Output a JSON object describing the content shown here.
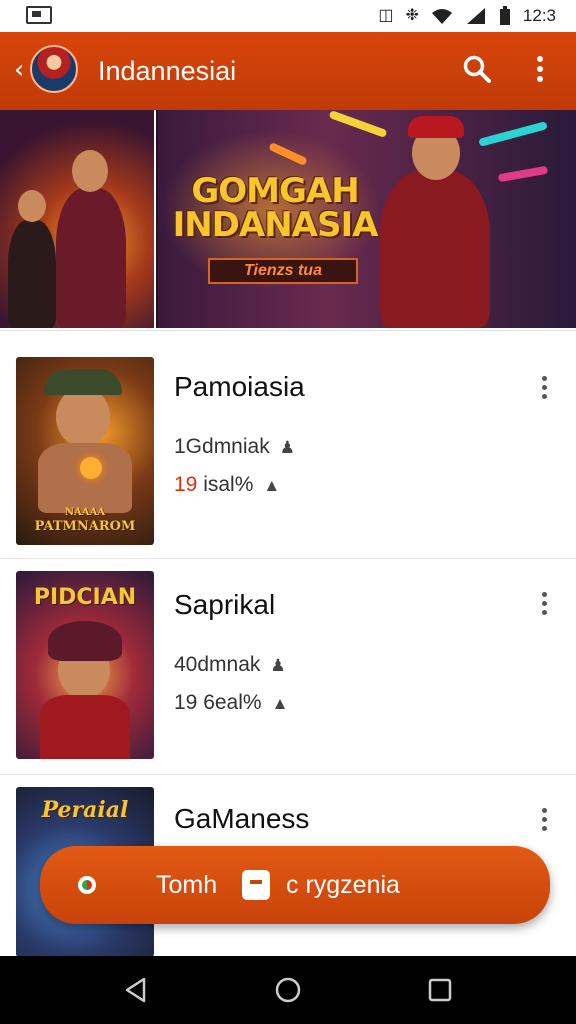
{
  "status_bar": {
    "time": "12:3",
    "icons": [
      "notification-icon",
      "vibrate-icon",
      "wifi-icon",
      "signal-icon",
      "battery-icon"
    ]
  },
  "app_bar": {
    "title": "Indannesiai",
    "back_icon": "chevron-left-icon",
    "search_icon": "search-icon",
    "more_icon": "more-vertical-icon"
  },
  "banner": {
    "title_line1": "GOMGAH",
    "title_line2": "INDANASIA",
    "subtitle": "Tienzs tua"
  },
  "list": {
    "items": [
      {
        "title": "Pamoiasia",
        "line1": "1Gdmniak",
        "line2_num": "19",
        "line2_text": "isal%",
        "thumb_label": "PATMNAROM",
        "thumb_top_label": "NAAAA"
      },
      {
        "title": "Saprikal",
        "line1": "40dmnak",
        "line2_num": "19",
        "line2_text": "6eal%",
        "thumb_label": "PIDCIAN",
        "thumb_top_label": ""
      },
      {
        "title": "GaManess",
        "line1": "",
        "line2_num": "",
        "line2_text": "",
        "thumb_label": "Peraial",
        "thumb_top_label": ""
      }
    ]
  },
  "action_bar": {
    "left_label": "Tomh",
    "right_label": "c rygzenia"
  },
  "nav": {
    "back": "nav-back-icon",
    "home": "nav-home-icon",
    "recents": "nav-recents-icon"
  },
  "colors": {
    "accent": "#c9420a",
    "app_bar": "#d8450b",
    "highlight": "#e03010"
  }
}
